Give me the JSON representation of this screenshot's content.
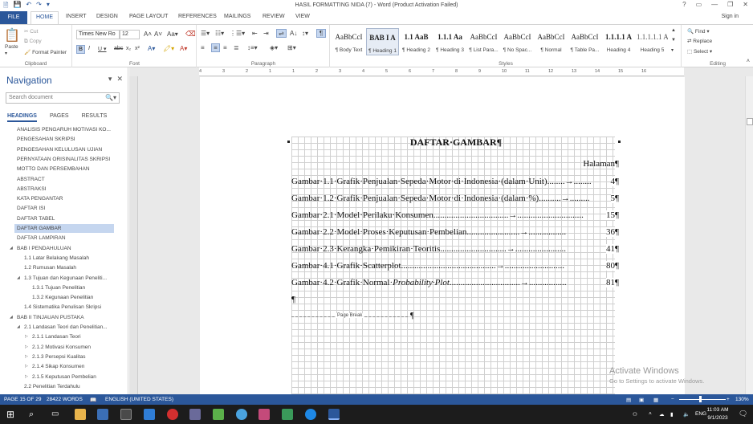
{
  "window": {
    "title": "HASIL FORMATTING NIDA (7) - Word (Product Activation Failed)",
    "controls": [
      "?",
      "▭",
      "—",
      "❐",
      "✕"
    ]
  },
  "ribbon_tabs": [
    "FILE",
    "HOME",
    "INSERT",
    "DESIGN",
    "PAGE LAYOUT",
    "REFERENCES",
    "MAILINGS",
    "REVIEW",
    "VIEW"
  ],
  "active_tab": "HOME",
  "sign_in": "Sign in",
  "clipboard": {
    "paste": "Paste",
    "cut": "Cut",
    "copy": "Copy",
    "format_painter": "Format Painter",
    "label": "Clipboard"
  },
  "font": {
    "name": "Times New Ro",
    "size": "12",
    "label": "Font"
  },
  "paragraph": {
    "label": "Paragraph"
  },
  "styles": {
    "label": "Styles",
    "items": [
      {
        "preview": "AaBbCcI",
        "name": "¶ Body Text"
      },
      {
        "preview": "BAB I  A",
        "name": "¶ Heading 1"
      },
      {
        "preview": "1.1  AaB",
        "name": "¶ Heading 2"
      },
      {
        "preview": "1.1.1  Aa",
        "name": "¶ Heading 3"
      },
      {
        "preview": "AaBbCcI",
        "name": "¶ List Para..."
      },
      {
        "preview": "AaBbCcI",
        "name": "¶ No Spac..."
      },
      {
        "preview": "AaBbCcI",
        "name": "¶ Normal"
      },
      {
        "preview": "AaBbCcI",
        "name": "¶ Table Pa..."
      },
      {
        "preview": "1.1.1.1 A",
        "name": "Heading 4"
      },
      {
        "preview": "1.1.1.1.1 A",
        "name": "Heading 5"
      }
    ]
  },
  "editing": {
    "label": "Editing",
    "find": "Find",
    "replace": "Replace",
    "select": "Select"
  },
  "navigation": {
    "title": "Navigation",
    "search_placeholder": "Search document",
    "tabs": [
      "HEADINGS",
      "PAGES",
      "RESULTS"
    ],
    "items": [
      {
        "text": "ANALISIS PENGARUH MOTIVASI KO...",
        "level": 0,
        "exp": ""
      },
      {
        "text": "PENGESAHAN SKRIPSI",
        "level": 0,
        "exp": ""
      },
      {
        "text": "PENGESAHAN KELULUSAN UJIAN",
        "level": 0,
        "exp": ""
      },
      {
        "text": "PERNYATAAN ORISINALITAS SKRIPSI",
        "level": 0,
        "exp": ""
      },
      {
        "text": "MOTTO DAN PERSEMBAHAN",
        "level": 0,
        "exp": ""
      },
      {
        "text": "ABSTRACT",
        "level": 0,
        "exp": ""
      },
      {
        "text": "ABSTRAKSI",
        "level": 0,
        "exp": ""
      },
      {
        "text": "KATA PENGANTAR",
        "level": 0,
        "exp": ""
      },
      {
        "text": "DAFTAR ISI",
        "level": 0,
        "exp": ""
      },
      {
        "text": "DAFTAR TABEL",
        "level": 0,
        "exp": ""
      },
      {
        "text": "DAFTAR GAMBAR",
        "level": 0,
        "exp": "",
        "selected": true
      },
      {
        "text": "DAFTAR LAMPIRAN",
        "level": 0,
        "exp": ""
      },
      {
        "text": "BAB I   PENDAHULUAN",
        "level": 0,
        "exp": "◢"
      },
      {
        "text": "1.1 Latar Belakang Masalah",
        "level": 1,
        "exp": ""
      },
      {
        "text": "1.2 Rumusan Masalah",
        "level": 1,
        "exp": ""
      },
      {
        "text": "1.3 Tujuan dan Kegunaan Peneliti...",
        "level": 1,
        "exp": "◢"
      },
      {
        "text": "1.3.1 Tujuan Penelitian",
        "level": 2,
        "exp": ""
      },
      {
        "text": "1.3.2 Kegunaan Penelitian",
        "level": 2,
        "exp": ""
      },
      {
        "text": "1.4 Sistematika Penulisan Skripsi",
        "level": 1,
        "exp": ""
      },
      {
        "text": "BAB II   TINJAUAN PUSTAKA",
        "level": 0,
        "exp": "◢"
      },
      {
        "text": "2.1 Landasan Teori dan Penelitian...",
        "level": 1,
        "exp": "◢"
      },
      {
        "text": "2.1.1 Landasan Teori",
        "level": 2,
        "exp": "▷"
      },
      {
        "text": "2.1.2 Motivasi Konsumen",
        "level": 2,
        "exp": "▷"
      },
      {
        "text": "2.1.3 Persepsi Kualitas",
        "level": 2,
        "exp": "▷"
      },
      {
        "text": "2.1.4 Sikap Konsumen",
        "level": 2,
        "exp": "▷"
      },
      {
        "text": "2.1.5 Keputusan Pembelian",
        "level": 2,
        "exp": "▷"
      },
      {
        "text": "2.2 Penelitian Terdahulu",
        "level": 1,
        "exp": ""
      }
    ]
  },
  "ruler_numbers": [
    "4",
    "3",
    "2",
    "1",
    "1",
    "2",
    "3",
    "4",
    "5",
    "6",
    "7",
    "8",
    "9",
    "10",
    "11",
    "12",
    "13",
    "14",
    "15",
    "16"
  ],
  "document": {
    "title": "DAFTAR·GAMBAR¶",
    "halaman": "Halaman¶",
    "entries": [
      {
        "label": "Gambar·1.1·Grafik·Penjualan·Sepeda·Motor·di·Indonesia·(dalam·Unit)",
        "leader": "........→........",
        "page": "4¶"
      },
      {
        "label": "Gambar·1.2·Grafik·Penjualan·Sepeda·Motor·di·Indonesia·(dalam·%)",
        "leader": "..........→.........",
        "page": "5¶"
      },
      {
        "label": "Gambar·2.1·Model·Perilaku·Konsumen",
        "leader": "..................................→..............................",
        "page": "15¶"
      },
      {
        "label": "Gambar·2.2·Model·Proses·Keputusan·Pembelian",
        "leader": "........................→.................",
        "page": "36¶"
      },
      {
        "label": "Gambar·2.3·Kerangka·Pemikiran·Teoritis",
        "leader": "..............................→.......................",
        "page": "41¶"
      },
      {
        "label": "Gambar·4.1·Grafik·Scatterplot",
        "leader": "...........................................→...........................",
        "page": "80¶"
      },
      {
        "label_prefix": "Gambar·4.2·Grafik·Normal·",
        "label_italic": "Probability·Plot",
        "leader": "................................→.................",
        "page": "81¶"
      }
    ],
    "empty_para": "¶",
    "page_break": "Page Break",
    "page_break_mark": "¶"
  },
  "watermark": {
    "line1": "Activate Windows",
    "line2": "Go to Settings to activate Windows."
  },
  "status": {
    "page": "PAGE 15 OF 29",
    "words": "28422 WORDS",
    "language": "ENGLISH (UNITED STATES)",
    "zoom": "130%"
  },
  "taskbar": {
    "language": "ENG",
    "time": "11:03 AM",
    "date": "9/1/2023"
  }
}
